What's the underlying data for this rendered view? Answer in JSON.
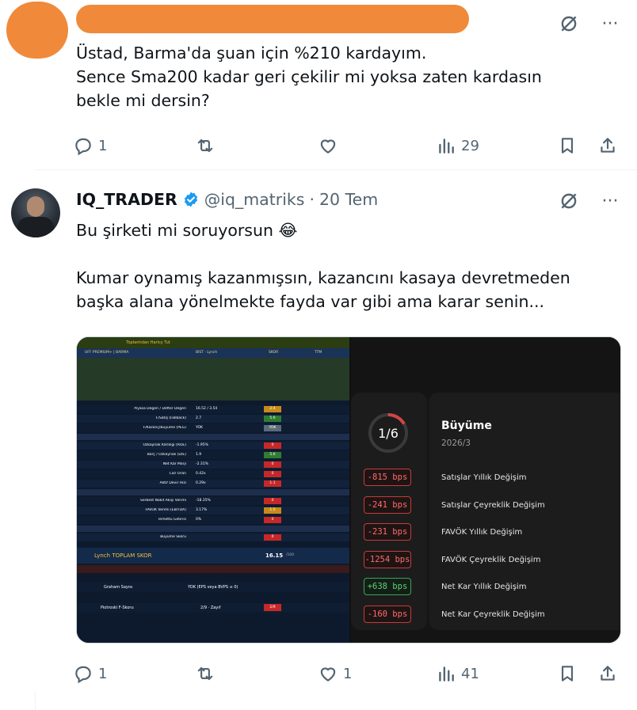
{
  "tweet1": {
    "text": "Üstad, Barma'da şuan için %210 kardayım.\nSence Sma200 kadar geri çekilir mi yoksa zaten kardasın\nbekle mi dersin?",
    "replies": "1",
    "views": "29"
  },
  "tweet2": {
    "display_name": "IQ_TRADER",
    "handle": "@iq_matriks",
    "dot": "·",
    "date": "20 Tem",
    "text": "Bu şirketi mi soruyorsun 😂\n\nKumar oynamış kazanmışsın, kazancını kasaya devretmeden\nbaşka alana yönelmekte fayda var gibi ama karar senin...",
    "replies": "1",
    "likes": "1",
    "views": "41"
  },
  "menu": {
    "grok_icon": "slash-circle-icon",
    "more_label": "···"
  },
  "colors": {
    "text": "#0f1419",
    "secondary": "#536471",
    "verified": "#1d9bf0",
    "redacted": "#f08a3a"
  },
  "media_right": {
    "score": "1/6",
    "title": "Büyüme",
    "subtitle": "2026/3",
    "rows": [
      {
        "bps": "-815 bps",
        "label": "Satışlar Yıllık Değişim",
        "sign": "neg"
      },
      {
        "bps": "-241 bps",
        "label": "Satışlar Çeyreklik Değişim",
        "sign": "neg"
      },
      {
        "bps": "-231 bps",
        "label": "FAVÖK Yıllık Değişim",
        "sign": "neg"
      },
      {
        "bps": "-1254 bps",
        "label": "FAVÖK Çeyreklik Değişim",
        "sign": "neg"
      },
      {
        "bps": "+638 bps",
        "label": "Net Kar Yıllık Değişim",
        "sign": "pos"
      },
      {
        "bps": "-160 bps",
        "label": "Net Kar Çeyreklik Değişim",
        "sign": "neg"
      }
    ]
  },
  "media_left": {
    "banner": "Toplantıdan Haricy Tut",
    "cols": [
      "UFF PREMIUM+ | BARMA",
      "BIST · Lynch",
      "SKOR",
      "TTM"
    ],
    "rows": [
      {
        "label": "Piyasa Değeri / Defter Değeri",
        "value": "16.52 / 3.54",
        "score": "2.4",
        "c": "#c98a1a"
      },
      {
        "label": "F/Satış (Fallback)",
        "value": "2.7",
        "score": "5.6",
        "c": "#2e7d32"
      },
      {
        "label": "F/Kazanç/Büyüme (PEG)",
        "value": "YOK",
        "score": "YOK",
        "c": "#5c6b7a"
      },
      {
        "label": "Özkaynak Kârlılığı (ROE)",
        "value": "-1.95%",
        "score": "0",
        "c": "#c62828"
      },
      {
        "label": "Borç / Özkaynak (D/E)",
        "value": "1.9",
        "score": "5.6",
        "c": "#2e7d32"
      },
      {
        "label": "Net Kâr Marjı",
        "value": "-2.31%",
        "score": "0",
        "c": "#c62828"
      },
      {
        "label": "Cari Oran",
        "value": "0.42x",
        "score": "0",
        "c": "#c62828"
      },
      {
        "label": "Aktif Devir Hızı",
        "value": "0.29x",
        "score": "1.1",
        "c": "#c62828"
      },
      {
        "label": "Serbest Nakit Akışı Verimi",
        "value": "-18.35%",
        "score": "0",
        "c": "#c62828"
      },
      {
        "label": "FAVÖK Verimi (EBITDA)",
        "value": "3.17%",
        "score": "1.5",
        "c": "#c98a1a"
      },
      {
        "label": "Temettü Getirisi",
        "value": "0%",
        "score": "0",
        "c": "#c62828"
      },
      {
        "label": "Büyüme Skoru",
        "value": "",
        "score": "0",
        "c": "#c62828"
      }
    ],
    "total_label": "Lynch TOPLAM SKOR",
    "total_value": "16.15",
    "total_max": "/100",
    "graham": "Graham Sayısı",
    "graham_value": "YOK (EPS veya BVPS ≤ 0)",
    "piotroski": "Piotroski F-Skoru",
    "piotroski_value": "2/9 · Zayıf",
    "piotroski_score": "2/9"
  }
}
